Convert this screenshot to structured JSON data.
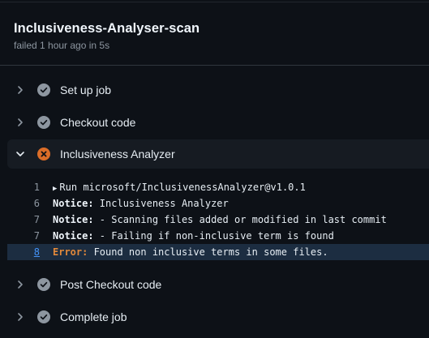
{
  "job": {
    "title": "Inclusiveness-Analyser-scan",
    "subtitle": "failed 1 hour ago in 5s"
  },
  "steps": [
    {
      "label": "Set up job",
      "status": "success"
    },
    {
      "label": "Checkout code",
      "status": "success"
    },
    {
      "label": "Inclusiveness Analyzer",
      "status": "failure"
    },
    {
      "label": "Post Checkout code",
      "status": "success"
    },
    {
      "label": "Complete job",
      "status": "success"
    }
  ],
  "log": [
    {
      "num": "1",
      "prefix": "▶ ",
      "keyword": "",
      "text": "Run microsoft/InclusivenessAnalyzer@v1.0.1"
    },
    {
      "num": "6",
      "prefix": "",
      "keyword": "Notice:",
      "text": " Inclusiveness Analyzer"
    },
    {
      "num": "7",
      "prefix": "",
      "keyword": "Notice:",
      "text": " - Scanning files added or modified in last commit"
    },
    {
      "num": "7",
      "prefix": "",
      "keyword": "Notice:",
      "text": " - Failing if non-inclusive term is found"
    },
    {
      "num": "8",
      "prefix": "",
      "keyword": "Error:",
      "text": " Found non inclusive terms in some files."
    }
  ],
  "colors": {
    "background": "#0d1117",
    "expanded_step_bg": "#161b22",
    "selected_line_bg": "#1c2d41",
    "success_icon": "#8d96a0",
    "failure_icon": "#db6d28",
    "error_keyword": "#e3893a",
    "link": "#4493f8"
  },
  "icons": {
    "collapsed": "chevron-right-icon",
    "expanded": "chevron-down-icon",
    "success": "check-circle-icon",
    "failure": "x-circle-icon"
  }
}
